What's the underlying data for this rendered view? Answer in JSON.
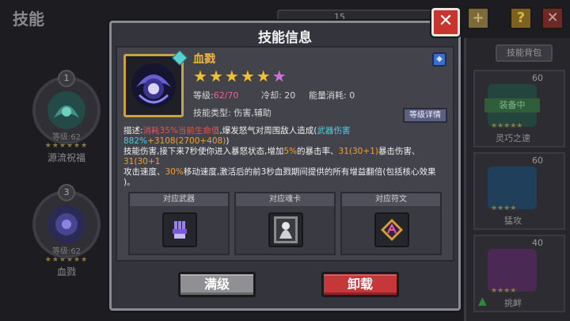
{
  "background": {
    "screen_title": "技能",
    "top_number": "15",
    "left_skills": [
      {
        "badge": "1",
        "level": "等级:62",
        "stars": "★★★★★★",
        "name": "源流祝福"
      },
      {
        "badge": "3",
        "level": "等级:62",
        "stars": "★★★★★★",
        "name": "血戮"
      }
    ],
    "right_tab": "技能背包",
    "right_cards": [
      {
        "level": "60",
        "status": "装备中",
        "stars": "★★★★★",
        "name": "灵巧之速"
      },
      {
        "level": "60",
        "stars": "★★★★",
        "name": "猛攻"
      },
      {
        "level": "40",
        "stars": "★★★★",
        "name": "挑衅"
      }
    ]
  },
  "dialog": {
    "title": "技能信息",
    "close_glyph": "✕",
    "skill": {
      "name": "血戮",
      "stars": [
        {
          "glyph": "★",
          "color": "#f0c030"
        },
        {
          "glyph": "★",
          "color": "#f0c030"
        },
        {
          "glyph": "★",
          "color": "#f0c030"
        },
        {
          "glyph": "★",
          "color": "#f0c030"
        },
        {
          "glyph": "★",
          "color": "#f0c030"
        },
        {
          "glyph": "★",
          "color": "#d070e0"
        }
      ],
      "level_label": "等级:",
      "level_value": "62/70",
      "cooldown_label": "冷却:",
      "cooldown_value": "20",
      "energy_label": "能量消耗:",
      "energy_value": "0",
      "type_label": "技能类型:",
      "type_value": "伤害,辅助",
      "detail_button": "等级详情"
    },
    "description": {
      "l1_a": "描述:",
      "l1_b": "消耗35%当前生命值",
      "l1_c": ",爆发怒气对周围敌人造成(",
      "l1_d": "武器伤害882%",
      "l1_e": "+3108(2700+408)",
      "l1_f": ")",
      "l2_a": "技能伤害,接下来7秒使你进入暴怒状态,增加",
      "l2_b": "5%",
      "l2_c": "的暴击率、",
      "l2_d": "31(30+1)",
      "l2_e": "暴击伤害、",
      "l2_f": "31(30+1",
      "l3_a": "攻击速度、",
      "l3_b": "30%",
      "l3_c": "移动速度,激活后的前3秒血戮期间提供的所有增益翻倍(包括核心效果",
      "l4": ")。"
    },
    "slots": [
      {
        "label": "对应武器"
      },
      {
        "label": "对应魂卡"
      },
      {
        "label": "对应符文"
      }
    ],
    "buttons": {
      "max_level": "满级",
      "unload": "卸载"
    }
  },
  "colors": {
    "accent_gold": "#c9a246",
    "highlight_red": "#f05050",
    "highlight_cyan": "#4ad0e0",
    "highlight_orange": "#f0a030",
    "level_pink": "#f0608a"
  }
}
